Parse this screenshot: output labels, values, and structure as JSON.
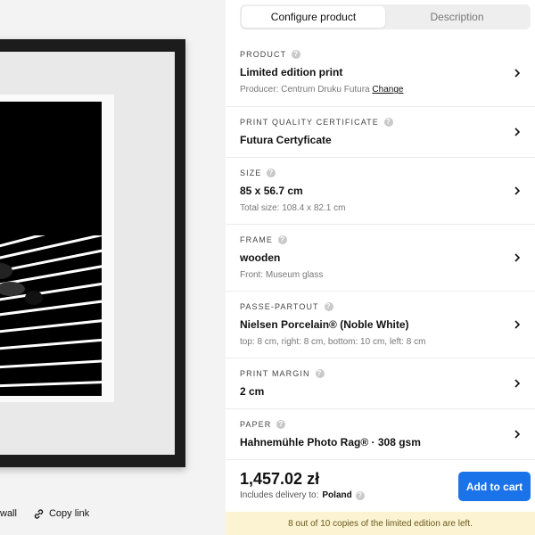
{
  "preview": {
    "actions": {
      "wall_label": "wall",
      "copy_link_label": "Copy link"
    }
  },
  "tabs": [
    {
      "label": "Configure product",
      "active": true
    },
    {
      "label": "Description",
      "active": false
    }
  ],
  "rows": {
    "product": {
      "label": "PRODUCT",
      "value": "Limited edition print",
      "sub": "Producer: Centrum Druku Futura",
      "sub_link": "Change"
    },
    "certificate": {
      "label": "PRINT QUALITY CERTIFICATE",
      "value": "Futura Certyficate"
    },
    "size": {
      "label": "SIZE",
      "value": "85 x 56.7 cm",
      "sub": "Total size: 108.4 x 82.1 cm"
    },
    "frame": {
      "label": "FRAME",
      "value": "wooden",
      "sub": "Front: Museum glass"
    },
    "passepartout": {
      "label": "PASSE-PARTOUT",
      "value": "Nielsen Porcelain® (Noble White)",
      "sub": "top: 8 cm, right: 8 cm, bottom: 10 cm, left: 8 cm"
    },
    "margin": {
      "label": "PRINT MARGIN",
      "value": "2 cm"
    },
    "paper": {
      "label": "PAPER",
      "value": "Hahnemühle Photo Rag® · 308 gsm"
    }
  },
  "footer": {
    "price": "1,457.02 zł",
    "delivery_prefix": "Includes delivery to:",
    "delivery_country": "Poland",
    "add_to_cart": "Add to cart",
    "notice": "8 out of 10 copies of the limited edition are left."
  },
  "colors": {
    "accent": "#1a73e8",
    "notice_bg": "#fbf3d1"
  }
}
